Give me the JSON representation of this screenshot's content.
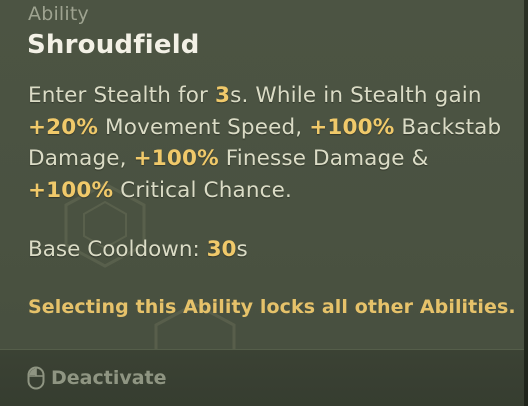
{
  "tooltip": {
    "category": "Ability",
    "title": "Shroudfield",
    "description": {
      "p1": "Enter Stealth for ",
      "v1": "3",
      "p2": "s. While in Stealth gain ",
      "v2": "+20%",
      "p3": " Movement Speed, ",
      "v3": "+100%",
      "p4": " Backstab Damage, ",
      "v4": "+100%",
      "p5": " Finesse Damage & ",
      "v5": "+100%",
      "p6": " Critical Chance."
    },
    "cooldown": {
      "label": "Base Cooldown: ",
      "value": "30",
      "unit": "s"
    },
    "warning": "Selecting this Ability locks all other Abilities.",
    "action": {
      "icon": "mouse-icon",
      "label": "Deactivate"
    }
  },
  "colors": {
    "highlight": "#f0c96a",
    "warning": "#e6c26a",
    "body_text": "#dbdcc6",
    "title": "#f3f1e6",
    "background": "#4a5241"
  }
}
